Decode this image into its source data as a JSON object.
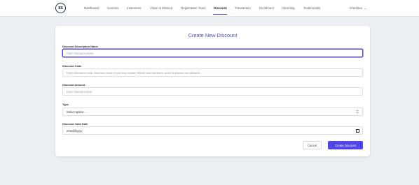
{
  "brand": {
    "logo_text": "ES"
  },
  "nav": {
    "items": [
      {
        "label": "Dashboard"
      },
      {
        "label": "Courses"
      },
      {
        "label": "Instructors"
      },
      {
        "label": "Vision & Mission"
      },
      {
        "label": "Registration Years"
      },
      {
        "label": "Discount",
        "active": true
      },
      {
        "label": "Transaction"
      },
      {
        "label": "Enrollment"
      },
      {
        "label": "Attending"
      },
      {
        "label": "Testimonials"
      }
    ],
    "user": {
      "name": "Christian",
      "chevron": "⌄"
    }
  },
  "form": {
    "title": "Create New Discount",
    "fields": {
      "name": {
        "label": "Discount Description Name",
        "placeholder": "Enter discount name"
      },
      "code": {
        "label": "Discount Code",
        "placeholder": "Enter discount code. Discount code must only contain letters and numbers, and no spaces are allowed."
      },
      "amount": {
        "label": "Discount Amount",
        "placeholder": "Enter discount total"
      },
      "type": {
        "label": "Type",
        "value": "Select option..."
      },
      "valid_date": {
        "label": "Discount Valid Date",
        "value": "mm/dd/yyyy"
      }
    },
    "buttons": {
      "cancel": "Cancel",
      "create": "Create Discount"
    }
  },
  "colors": {
    "accent": "#4f46e5",
    "background": "#eceef1",
    "card": "#ffffff",
    "nav_text": "#555a66"
  },
  "icons": {
    "select_arrow": "select-updown-icon",
    "calendar": "calendar-icon",
    "user_chevron": "chevron-down-icon"
  }
}
